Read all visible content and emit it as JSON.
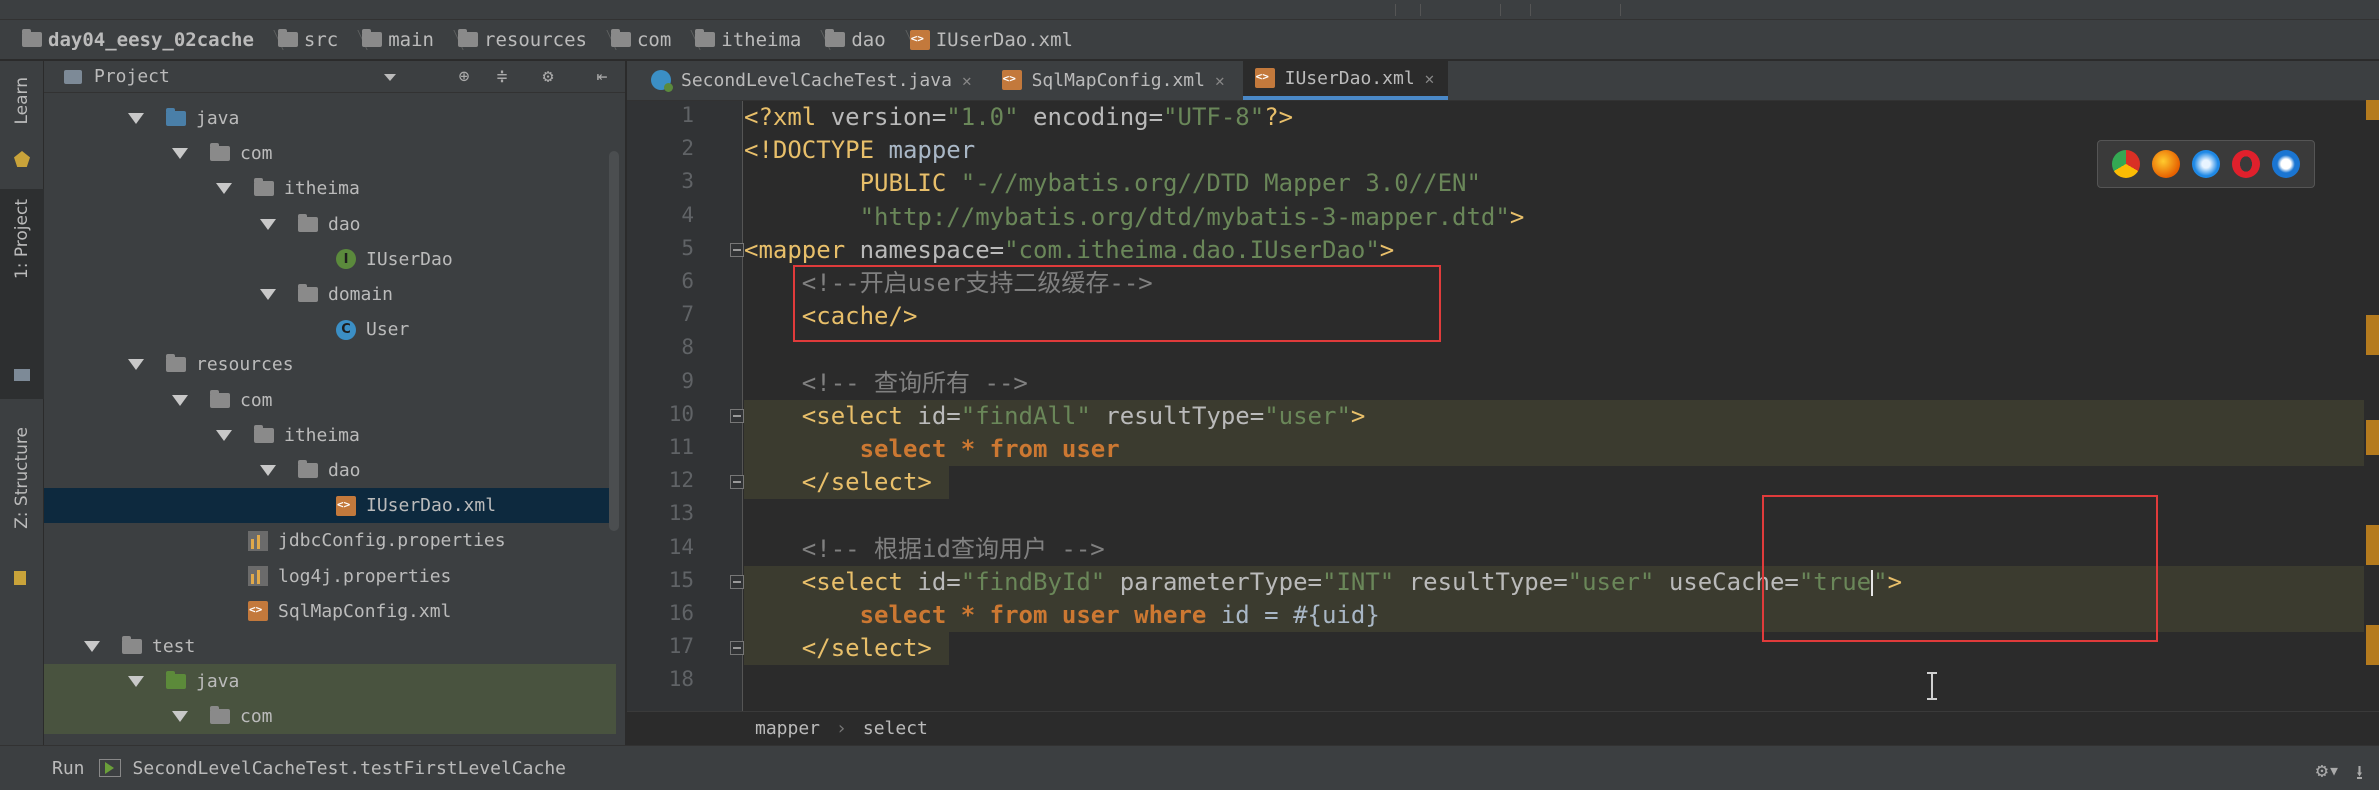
{
  "breadcrumbs": [
    {
      "label": "day04_eesy_02cache",
      "icon": "folder-icon",
      "bold": true
    },
    {
      "label": "src",
      "icon": "folder-icon"
    },
    {
      "label": "main",
      "icon": "folder-icon"
    },
    {
      "label": "resources",
      "icon": "resources-folder-icon"
    },
    {
      "label": "com",
      "icon": "folder-icon"
    },
    {
      "label": "itheima",
      "icon": "folder-icon"
    },
    {
      "label": "dao",
      "icon": "folder-icon"
    },
    {
      "label": "IUserDao.xml",
      "icon": "xml-file-icon"
    }
  ],
  "left_strip": {
    "learn": "Learn",
    "project": "1: Project",
    "structure": "Z: Structure"
  },
  "panel": {
    "title": "Project"
  },
  "tree": [
    {
      "label": "java",
      "depth": 1,
      "icon": "blue-folder",
      "arrow": true
    },
    {
      "label": "com",
      "depth": 2,
      "icon": "folder",
      "arrow": true
    },
    {
      "label": "itheima",
      "depth": 3,
      "icon": "folder",
      "arrow": true
    },
    {
      "label": "dao",
      "depth": 4,
      "icon": "folder",
      "arrow": true
    },
    {
      "label": "IUserDao",
      "depth": 5,
      "icon": "interface",
      "arrow": false
    },
    {
      "label": "domain",
      "depth": 4,
      "icon": "folder",
      "arrow": true
    },
    {
      "label": "User",
      "depth": 5,
      "icon": "class",
      "arrow": false
    },
    {
      "label": "resources",
      "depth": 1,
      "icon": "res-folder",
      "arrow": true
    },
    {
      "label": "com",
      "depth": 2,
      "icon": "folder",
      "arrow": true
    },
    {
      "label": "itheima",
      "depth": 3,
      "icon": "folder",
      "arrow": true
    },
    {
      "label": "dao",
      "depth": 4,
      "icon": "folder",
      "arrow": true
    },
    {
      "label": "IUserDao.xml",
      "depth": 5,
      "icon": "xml",
      "arrow": false,
      "selected": true
    },
    {
      "label": "jdbcConfig.properties",
      "depth": 3,
      "icon": "properties",
      "arrow": false
    },
    {
      "label": "log4j.properties",
      "depth": 3,
      "icon": "properties",
      "arrow": false
    },
    {
      "label": "SqlMapConfig.xml",
      "depth": 3,
      "icon": "xml",
      "arrow": false
    },
    {
      "label": "test",
      "depth": 0,
      "icon": "folder",
      "arrow": true
    },
    {
      "label": "java",
      "depth": 1,
      "icon": "green-folder",
      "arrow": true,
      "test": true
    },
    {
      "label": "com",
      "depth": 2,
      "icon": "folder",
      "arrow": true,
      "test": true
    }
  ],
  "tabs": [
    {
      "label": "SecondLevelCacheTest.java",
      "icon": "java-class-icon",
      "active": false
    },
    {
      "label": "SqlMapConfig.xml",
      "icon": "xml-file-icon",
      "active": false
    },
    {
      "label": "IUserDao.xml",
      "icon": "xml-file-icon",
      "active": true
    }
  ],
  "code_lines": [
    {
      "n": "1",
      "tokens": [
        [
          "t-tag",
          "<?xml "
        ],
        [
          "t-attr",
          "version="
        ],
        [
          "t-val",
          "\"1.0\" "
        ],
        [
          "t-attr",
          "encoding="
        ],
        [
          "t-val",
          "\"UTF-8\""
        ],
        [
          "t-tag",
          "?>"
        ]
      ]
    },
    {
      "n": "2",
      "tokens": [
        [
          "t-tag",
          "<!DOCTYPE "
        ],
        [
          "t-plain",
          "mapper"
        ]
      ]
    },
    {
      "n": "3",
      "tokens": [
        [
          "t-plain",
          "        "
        ],
        [
          "t-tag",
          "PUBLIC "
        ],
        [
          "t-val",
          "\"-//mybatis.org//DTD Mapper 3.0//EN\""
        ]
      ]
    },
    {
      "n": "4",
      "tokens": [
        [
          "t-plain",
          "        "
        ],
        [
          "t-val",
          "\"http://mybatis.org/dtd/mybatis-3-mapper.dtd\""
        ],
        [
          "t-tag",
          ">"
        ]
      ]
    },
    {
      "n": "5",
      "tokens": [
        [
          "t-tag",
          "<mapper "
        ],
        [
          "t-attr",
          "namespace="
        ],
        [
          "t-val",
          "\"com.itheima.dao.IUserDao\""
        ],
        [
          "t-tag",
          ">"
        ]
      ]
    },
    {
      "n": "6",
      "tokens": [
        [
          "t-plain",
          "    "
        ],
        [
          "t-cmt",
          "<!--开启user支持二级缓存-->"
        ]
      ]
    },
    {
      "n": "7",
      "tokens": [
        [
          "t-plain",
          "    "
        ],
        [
          "t-tag",
          "<cache/>"
        ]
      ]
    },
    {
      "n": "8",
      "tokens": []
    },
    {
      "n": "9",
      "tokens": [
        [
          "t-plain",
          "    "
        ],
        [
          "t-cmt",
          "<!-- 查询所有 -->"
        ]
      ]
    },
    {
      "n": "10",
      "tokens": [
        [
          "t-plain",
          "    "
        ],
        [
          "t-tag",
          "<select "
        ],
        [
          "t-attr",
          "id="
        ],
        [
          "t-val",
          "\"findAll\" "
        ],
        [
          "t-attr",
          "resultType="
        ],
        [
          "t-val",
          "\"user\""
        ],
        [
          "t-tag",
          ">"
        ]
      ]
    },
    {
      "n": "11",
      "tokens": [
        [
          "t-plain",
          "        "
        ],
        [
          "t-kw",
          "select * from user"
        ]
      ]
    },
    {
      "n": "12",
      "tokens": [
        [
          "t-plain",
          "    "
        ],
        [
          "t-tag",
          "</select>"
        ]
      ]
    },
    {
      "n": "13",
      "tokens": []
    },
    {
      "n": "14",
      "tokens": [
        [
          "t-plain",
          "    "
        ],
        [
          "t-cmt",
          "<!-- 根据id查询用户 -->"
        ]
      ]
    },
    {
      "n": "15",
      "tokens": [
        [
          "t-plain",
          "    "
        ],
        [
          "t-tag",
          "<select "
        ],
        [
          "t-attr",
          "id="
        ],
        [
          "t-val",
          "\"findById\" "
        ],
        [
          "t-attr",
          "parameterType="
        ],
        [
          "t-val",
          "\"INT\" "
        ],
        [
          "t-attr",
          "resultType="
        ],
        [
          "t-val",
          "\"user\" "
        ],
        [
          "t-attr",
          "useCache="
        ],
        [
          "t-val",
          "\"true"
        ],
        [
          "caret",
          ""
        ],
        [
          "t-val",
          "\""
        ],
        [
          "t-tag",
          ">"
        ]
      ]
    },
    {
      "n": "16",
      "tokens": [
        [
          "t-plain",
          "        "
        ],
        [
          "t-kw",
          "select * from user where "
        ],
        [
          "t-plain",
          "id = #{uid}"
        ]
      ]
    },
    {
      "n": "17",
      "tokens": [
        [
          "t-plain",
          "    "
        ],
        [
          "t-tag",
          "</select>"
        ]
      ]
    },
    {
      "n": "18",
      "tokens": []
    }
  ],
  "editor_breadcrumbs": [
    "mapper",
    "select"
  ],
  "status": {
    "run_label": "Run",
    "run_config": "SecondLevelCacheTest.testFirstLevelCache"
  },
  "colors": {
    "background": "#2b2b2b",
    "panel": "#3c3f41",
    "selection": "#0d293e",
    "annotation_box": "#e03b3b",
    "tab_underline": "#4a88c7"
  }
}
